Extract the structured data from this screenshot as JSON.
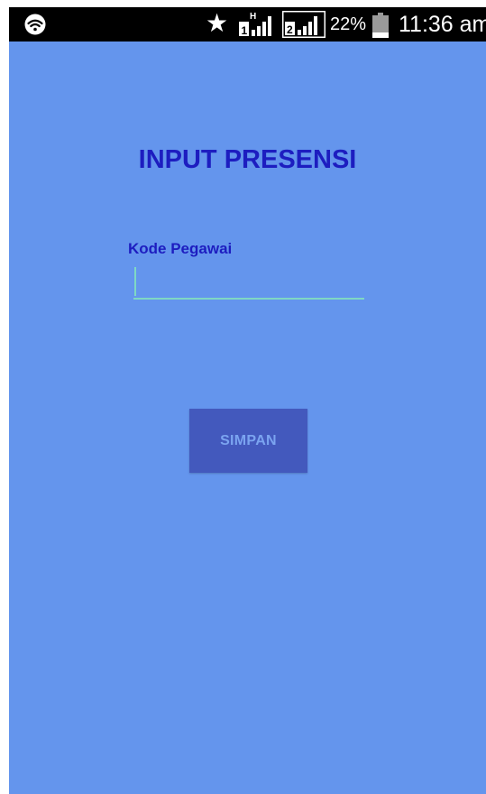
{
  "status_bar": {
    "icons": [
      "wifi-icon",
      "star-icon",
      "sim1-signal-icon",
      "sim2-signal-icon",
      "battery-icon"
    ],
    "sim1_network": "H",
    "sim1_label": "1",
    "sim2_label": "2",
    "battery_percent": "22%",
    "time": "11:36 am"
  },
  "screen": {
    "background": "#6495ED",
    "title": "INPUT PRESENSI",
    "title_color": "#1D1DC0"
  },
  "form": {
    "employee_code_label": "Kode Pegawai",
    "employee_code_value": "",
    "employee_code_placeholder": "",
    "accent_color": "#7FD8C4"
  },
  "actions": {
    "save_label": "SIMPAN",
    "save_bg": "#4359BD"
  }
}
